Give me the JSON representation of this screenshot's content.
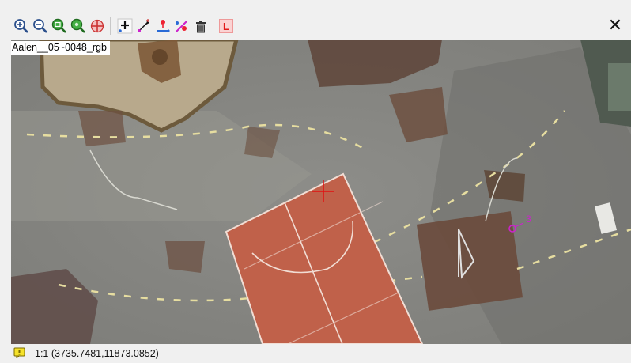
{
  "toolbar": {
    "buttons": [
      {
        "name": "zoom-in-icon"
      },
      {
        "name": "zoom-out-icon"
      },
      {
        "name": "zoom-fit-icon"
      },
      {
        "name": "zoom-layer-icon"
      },
      {
        "name": "pan-center-icon"
      },
      {
        "name": "add-point-icon"
      },
      {
        "name": "move-point-icon"
      },
      {
        "name": "point-to-line-icon"
      },
      {
        "name": "link-point-icon"
      },
      {
        "name": "delete-point-icon"
      },
      {
        "name": "label-icon",
        "label": "L"
      }
    ],
    "close_glyph": "✕"
  },
  "map": {
    "layer_label": "Aalen__05~0048_rgb",
    "point_label": "3"
  },
  "status": {
    "text": "1:1 (3735.7481,11873.0852)"
  },
  "colors": {
    "court": "#c0614a",
    "crosshair": "#e31010",
    "marker": "#cc22cc",
    "accent_green": "#2e9a2e"
  }
}
